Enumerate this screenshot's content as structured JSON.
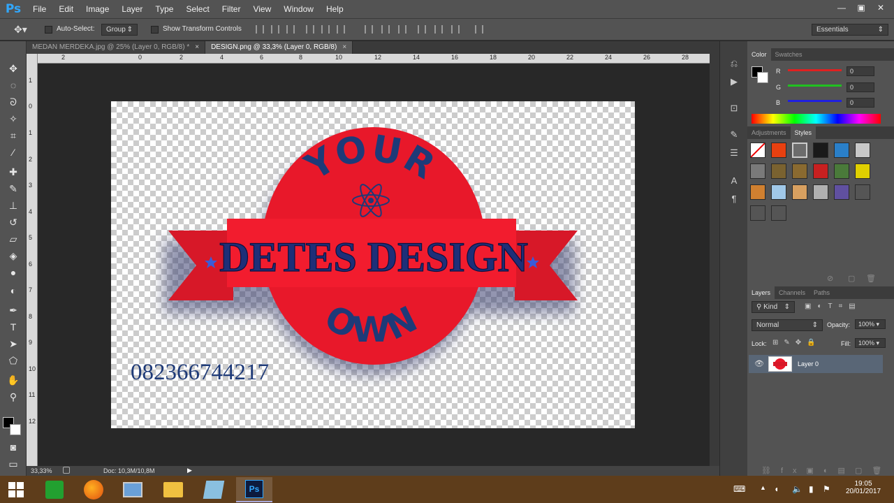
{
  "app": {
    "logo": "Ps"
  },
  "menu": [
    "File",
    "Edit",
    "Image",
    "Layer",
    "Type",
    "Select",
    "Filter",
    "View",
    "Window",
    "Help"
  ],
  "window_controls": [
    "—",
    "▣",
    "✕"
  ],
  "options": {
    "auto_select_label": "Auto-Select:",
    "auto_select_value": "Group",
    "transform_label": "Show Transform Controls",
    "workspace": "Essentials"
  },
  "tabs": [
    {
      "label": "MEDAN MERDEKA.jpg @ 25% (Layer 0, RGB/8) *",
      "close": "×",
      "active": false
    },
    {
      "label": "DESIGN.png @ 33,3% (Layer 0, RGB/8)",
      "close": "×",
      "active": true
    }
  ],
  "ruler_h": [
    "2",
    "0",
    "2",
    "4",
    "6",
    "8",
    "10",
    "12",
    "14",
    "16",
    "18",
    "20",
    "22",
    "24",
    "26",
    "28"
  ],
  "ruler_v": [
    "1",
    "0",
    "1",
    "2",
    "3",
    "4",
    "5",
    "6",
    "7",
    "8",
    "9",
    "10",
    "11",
    "12"
  ],
  "design": {
    "top_arc": "YOUR",
    "banner": "DETES DESIGN",
    "bottom_arc": "OWN",
    "phone": "082366744217",
    "colors": {
      "badge": "#e8182a",
      "banner": "#ef1b2b",
      "ribbon": "#d71828",
      "text": "#1e3a78",
      "star": "#3a5cd8"
    }
  },
  "status": {
    "zoom": "33,33%",
    "doc": "Doc: 10,3M/10,8M"
  },
  "color_panel": {
    "tabs": [
      "Color",
      "Swatches"
    ],
    "channels": [
      {
        "label": "R",
        "value": "0",
        "color": "#e02020"
      },
      {
        "label": "G",
        "value": "0",
        "color": "#20c020"
      },
      {
        "label": "B",
        "value": "0",
        "color": "#2020e0"
      }
    ]
  },
  "styles_panel": {
    "tabs": [
      "Adjustments",
      "Styles"
    ]
  },
  "layers_panel": {
    "tabs": [
      "Layers",
      "Channels",
      "Paths"
    ],
    "kind": "Kind",
    "blend_mode": "Normal",
    "opacity_label": "Opacity:",
    "opacity": "100%",
    "lock_label": "Lock:",
    "fill_label": "Fill:",
    "fill": "100%",
    "layers": [
      {
        "name": "Layer 0"
      }
    ]
  },
  "taskbar": {
    "time": "19:05",
    "date": "20/01/2017"
  }
}
